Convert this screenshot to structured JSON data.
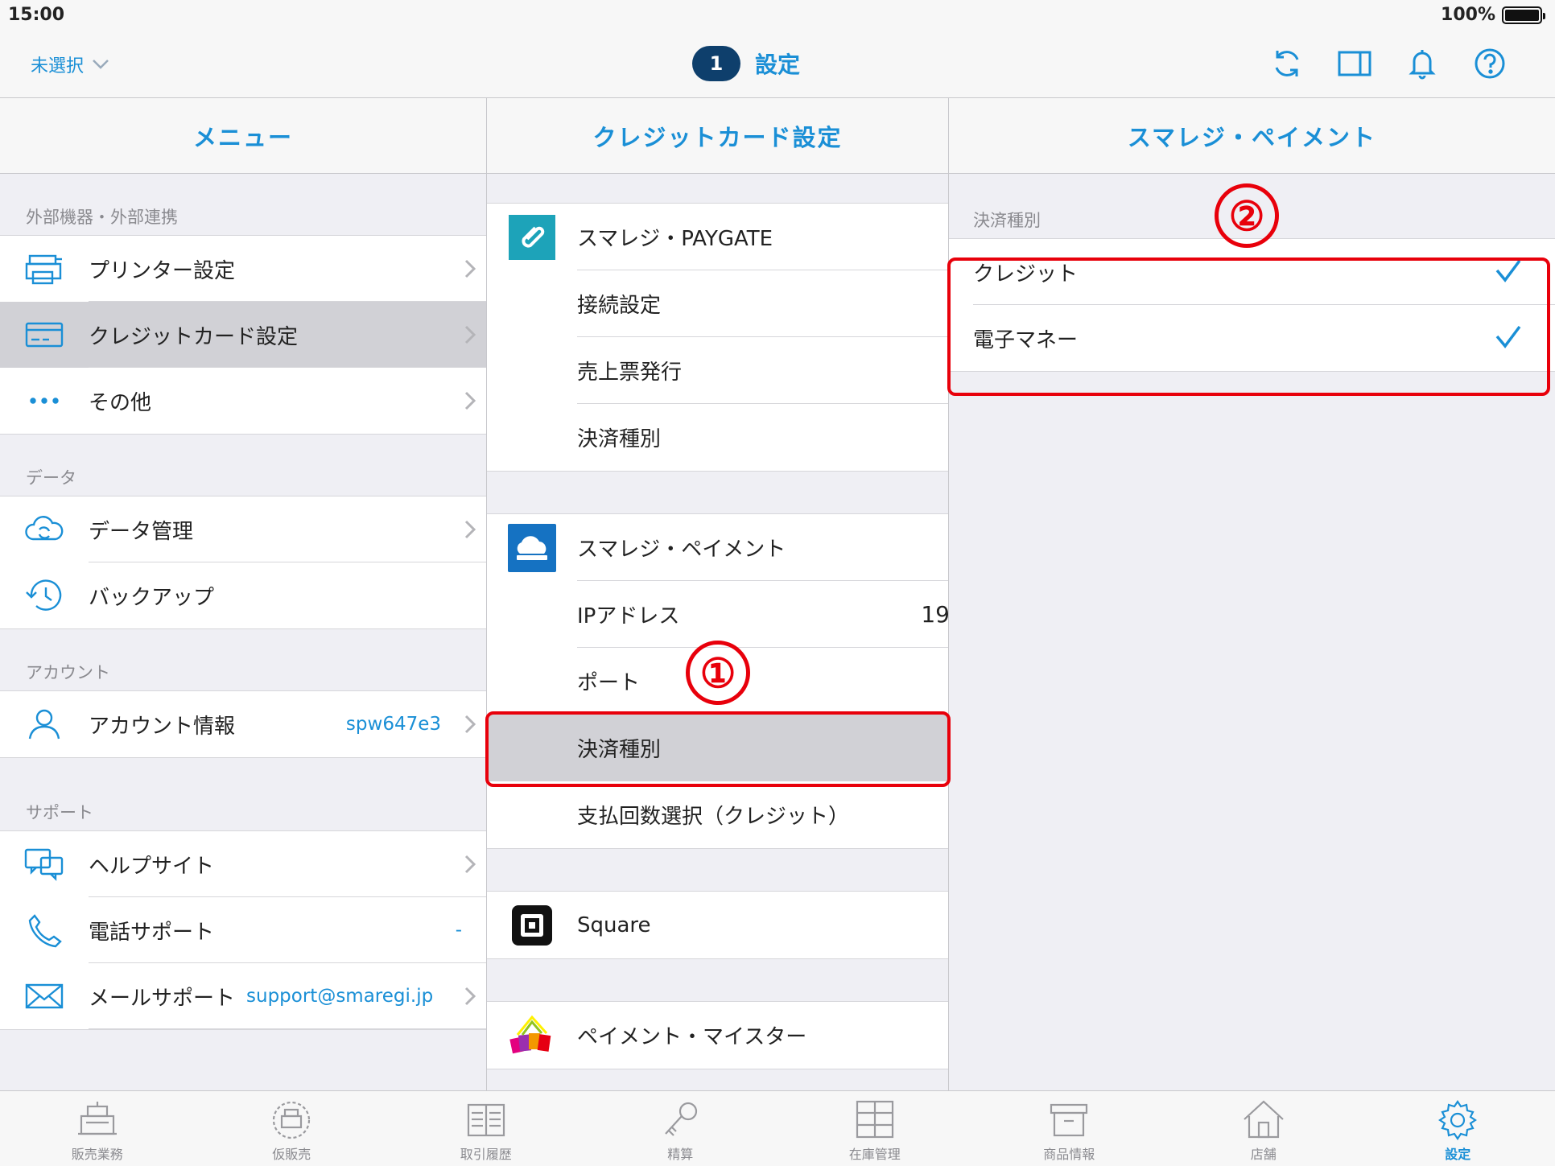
{
  "status": {
    "time": "15:00",
    "battery": "100%"
  },
  "nav": {
    "selector_label": "未選択",
    "badge": "1",
    "title": "設定"
  },
  "columns": {
    "menu_title": "メニュー",
    "credit_title": "クレジットカード設定",
    "payment_title": "スマレジ・ペイメント"
  },
  "menu": {
    "sections": [
      {
        "title": "外部機器・外部連携",
        "items": [
          {
            "label": "プリンター設定",
            "icon": "printer-icon"
          },
          {
            "label": "クレジットカード設定",
            "icon": "credit-card-icon",
            "selected": true
          },
          {
            "label": "その他",
            "icon": "more-icon"
          }
        ]
      },
      {
        "title": "データ",
        "items": [
          {
            "label": "データ管理",
            "icon": "cloud-sync-icon"
          },
          {
            "label": "バックアップ",
            "icon": "history-icon"
          }
        ]
      },
      {
        "title": "アカウント",
        "items": [
          {
            "label": "アカウント情報",
            "value": "spw647e3",
            "icon": "user-icon"
          }
        ]
      },
      {
        "title": "サポート",
        "items": [
          {
            "label": "ヘルプサイト",
            "icon": "help-chat-icon"
          },
          {
            "label": "電話サポート",
            "value": "-",
            "icon": "phone-icon"
          },
          {
            "label": "メールサポート",
            "value": "support@smaregi.jp",
            "icon": "mail-icon"
          }
        ]
      }
    ]
  },
  "credit": {
    "paygate": {
      "name": "スマレジ・PAYGATE",
      "items": [
        "接続設定",
        "売上票発行",
        "決済種別"
      ]
    },
    "payment": {
      "name": "スマレジ・ペイメント",
      "ip_label": "IPアドレス",
      "ip_value": "19",
      "port_label": "ポート",
      "type_label": "決済種別",
      "installment_label": "支払回数選択（クレジット）"
    },
    "square": {
      "name": "Square"
    },
    "meister": {
      "name": "ペイメント・マイスター"
    }
  },
  "payment_detail": {
    "section_title": "決済種別",
    "options": [
      {
        "label": "クレジット",
        "checked": true
      },
      {
        "label": "電子マネー",
        "checked": true
      }
    ]
  },
  "annotations": {
    "one": "①",
    "two": "②"
  },
  "tabs": [
    {
      "label": "販売業務",
      "icon": "register-icon"
    },
    {
      "label": "仮販売",
      "icon": "temp-sale-icon"
    },
    {
      "label": "取引履歴",
      "icon": "history-list-icon"
    },
    {
      "label": "精算",
      "icon": "key-icon"
    },
    {
      "label": "在庫管理",
      "icon": "inventory-icon"
    },
    {
      "label": "商品情報",
      "icon": "box-icon"
    },
    {
      "label": "店舗",
      "icon": "store-icon"
    },
    {
      "label": "設定",
      "icon": "gear-icon",
      "active": true
    }
  ],
  "colors": {
    "accent": "#1a8fd6",
    "annotation": "#e8000b",
    "badge": "#0e3f6c"
  }
}
